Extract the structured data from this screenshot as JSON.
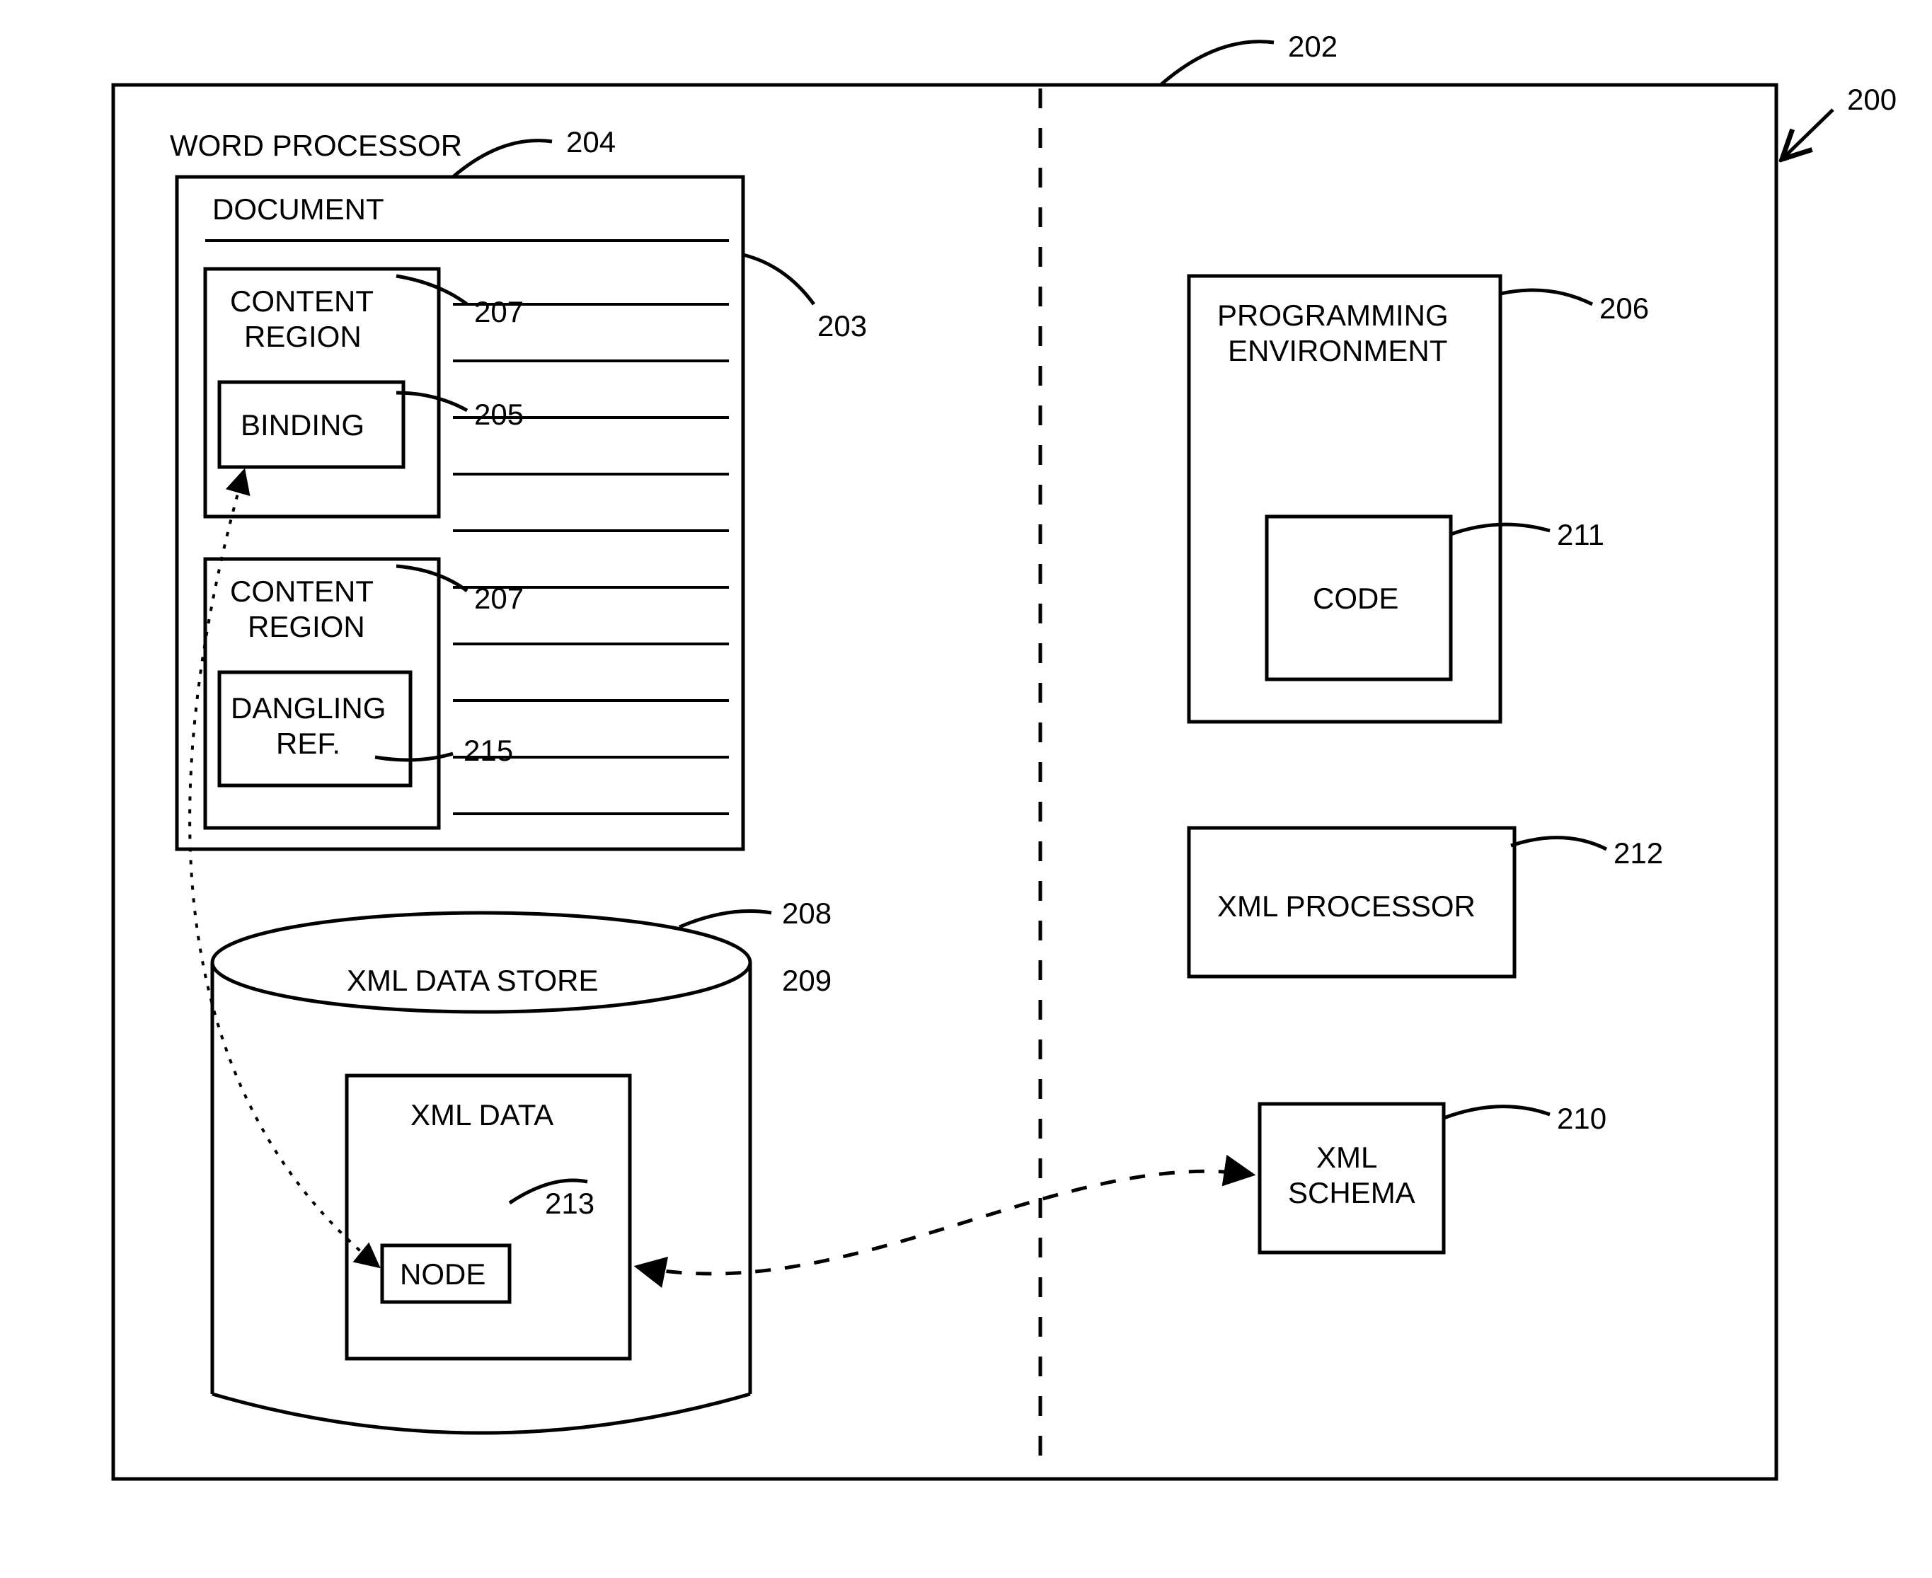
{
  "refs": {
    "r200": "200",
    "r202": "202",
    "r203": "203",
    "r204": "204",
    "r205": "205",
    "r206": "206",
    "r207a": "207",
    "r207b": "207",
    "r208": "208",
    "r209": "209",
    "r210": "210",
    "r211": "211",
    "r212": "212",
    "r213": "213",
    "r215": "215"
  },
  "labels": {
    "wordProcessor": "WORD PROCESSOR",
    "document": "DOCUMENT",
    "contentRegion1": "CONTENT",
    "contentRegion1b": "REGION",
    "binding": "BINDING",
    "contentRegion2": "CONTENT",
    "contentRegion2b": "REGION",
    "danglingRef1": "DANGLING",
    "danglingRef2": "REF.",
    "xmlDataStore": "XML DATA STORE",
    "xmlData": "XML DATA",
    "node": "NODE",
    "progEnv1": "PROGRAMMING",
    "progEnv2": "ENVIRONMENT",
    "code": "CODE",
    "xmlProcessor": "XML PROCESSOR",
    "xmlSchema1": "XML",
    "xmlSchema2": "SCHEMA"
  }
}
